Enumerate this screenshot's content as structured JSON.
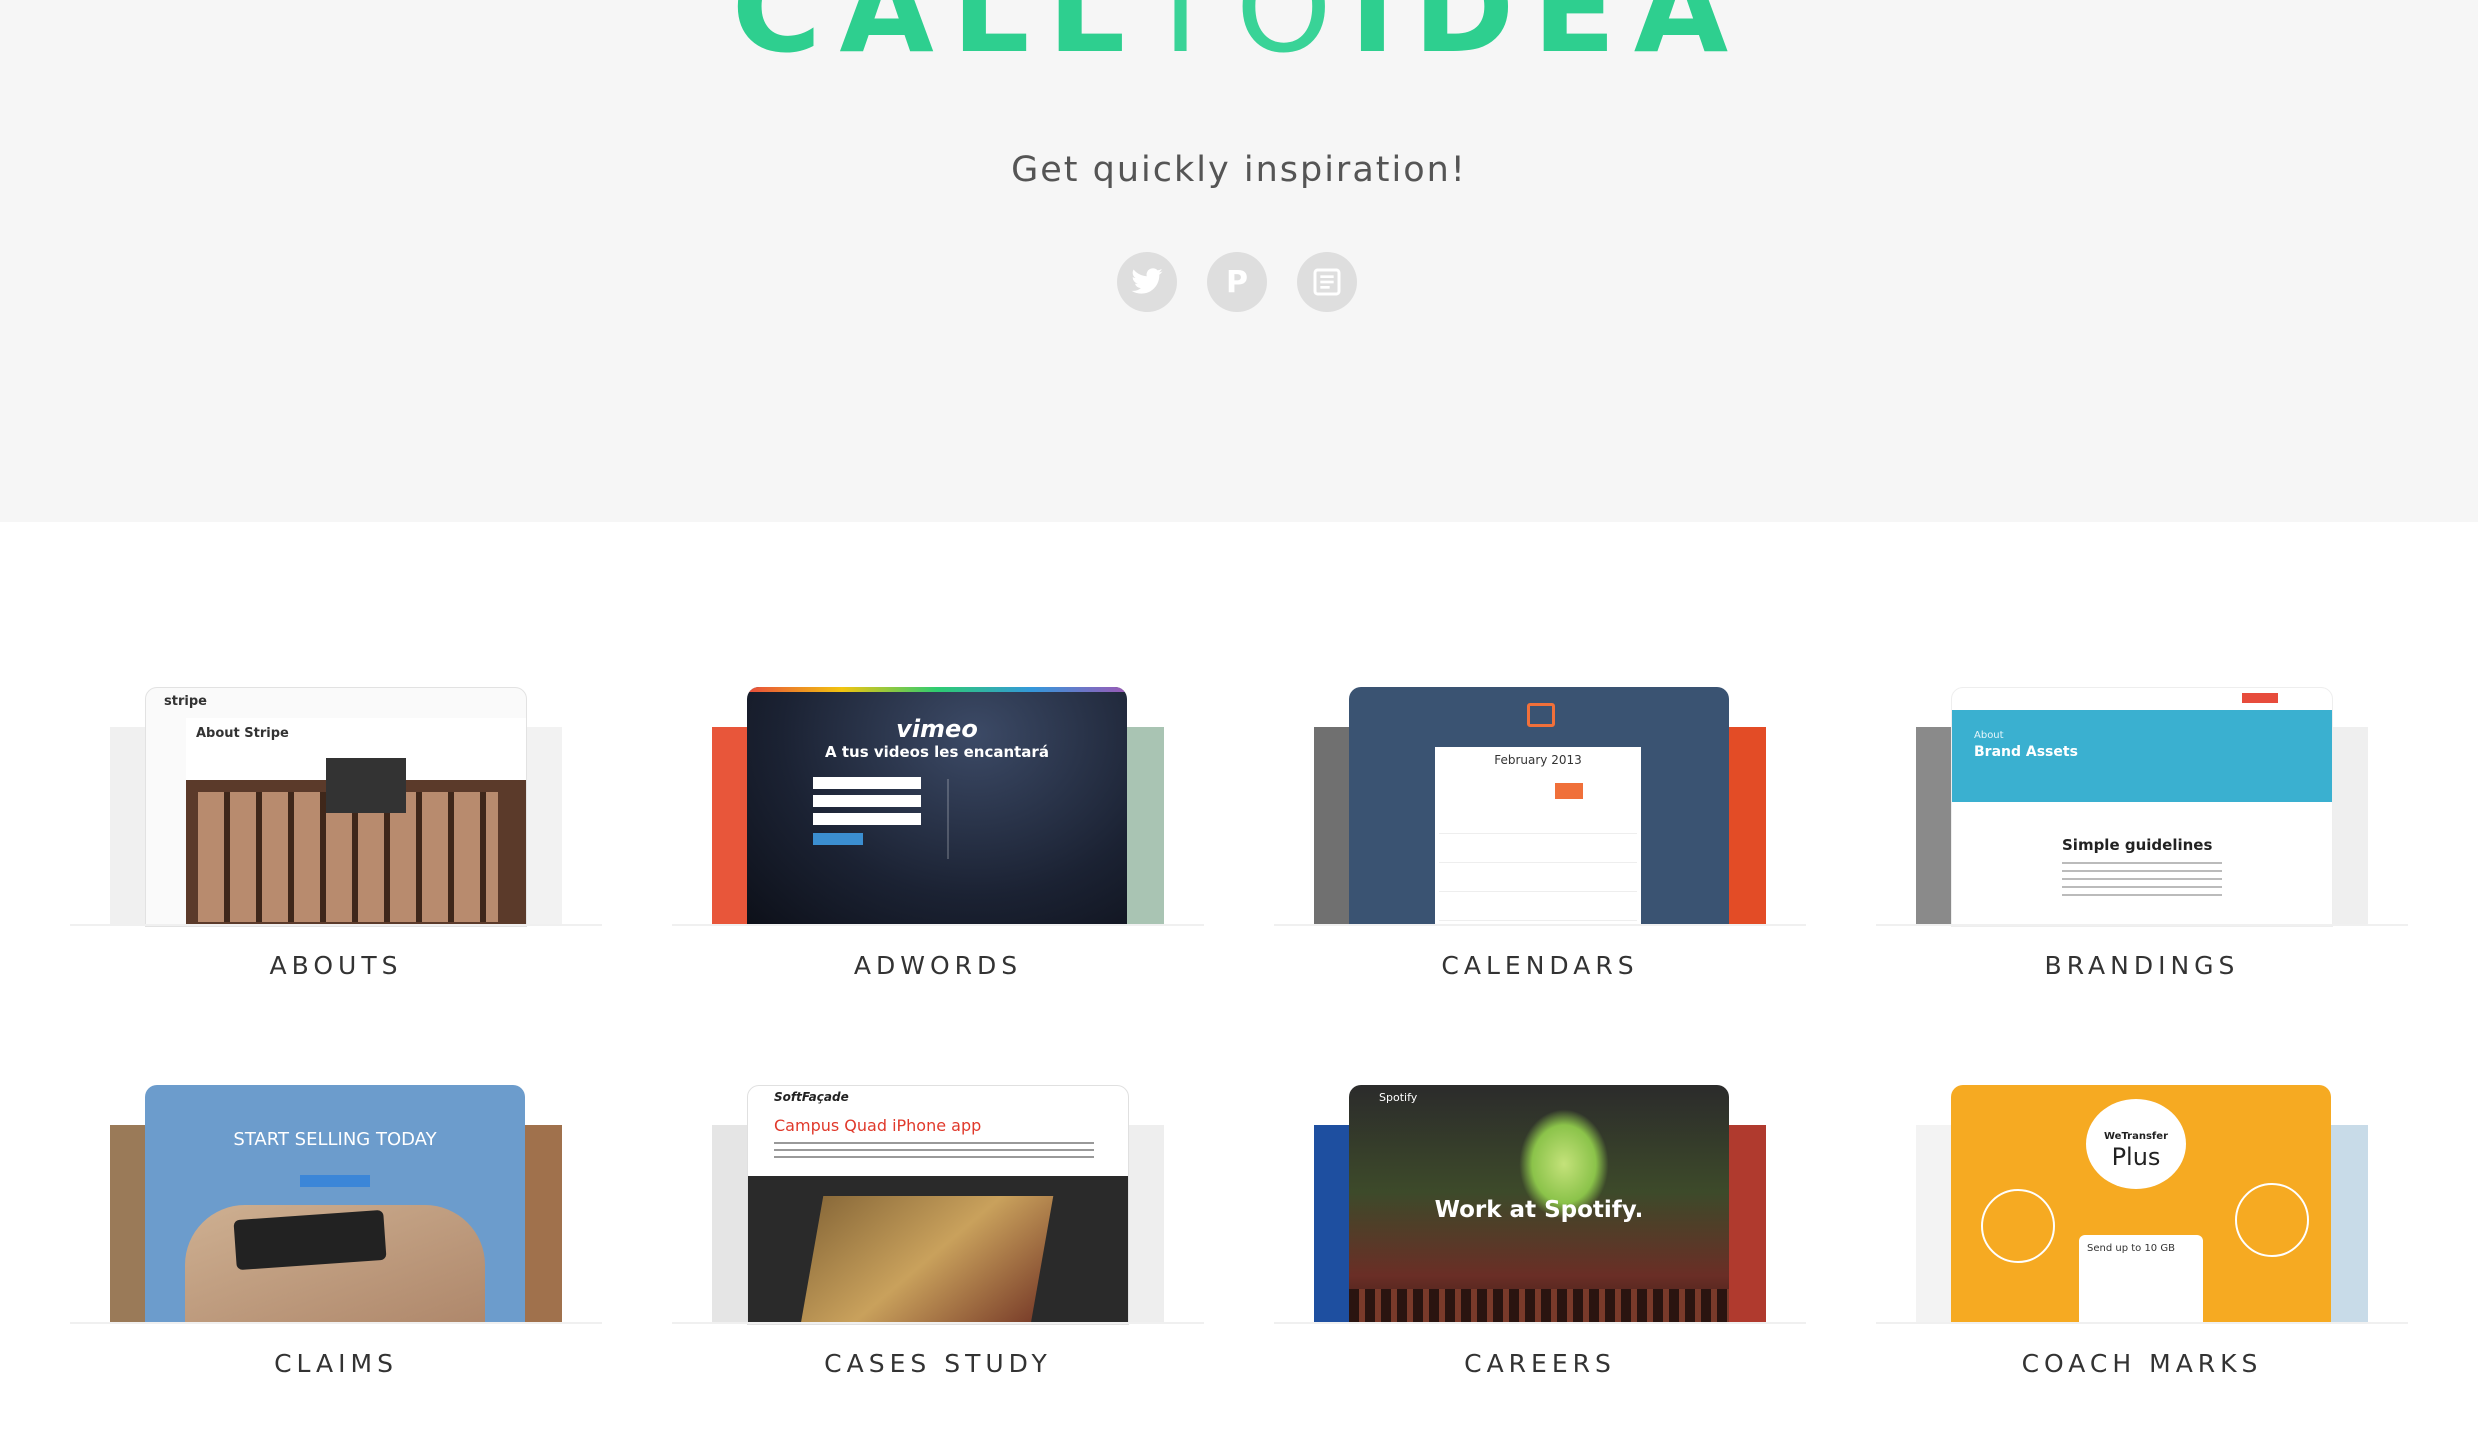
{
  "logo": {
    "part1": "CALL",
    "part2": "TO",
    "part3": "IDEA"
  },
  "tagline": "Get quickly inspiration!",
  "social": [
    {
      "icon": "twitter-icon",
      "glyph": "🐦"
    },
    {
      "icon": "pinterest-icon",
      "glyph": "P"
    },
    {
      "icon": "blog-icon",
      "glyph": "▤"
    }
  ],
  "categories": [
    {
      "title": "ABOUTS"
    },
    {
      "title": "ADWORDS"
    },
    {
      "title": "CALENDARS"
    },
    {
      "title": "BRANDINGS"
    },
    {
      "title": "CLAIMS"
    },
    {
      "title": "CASES STUDY"
    },
    {
      "title": "CAREERS"
    },
    {
      "title": "COACH MARKS"
    }
  ],
  "previews": {
    "abouts": {
      "brand": "stripe",
      "heading": "About Stripe"
    },
    "adwords": {
      "brand": "vimeo",
      "heading": "A tus videos les encantará"
    },
    "calendars": {
      "month": "February 2013"
    },
    "brandings": {
      "label": "About",
      "heading": "Brand Assets",
      "sub": "Simple guidelines"
    },
    "claims": {
      "heading": "START SELLING TODAY"
    },
    "cases": {
      "brand": "SoftFaçade",
      "heading": "Campus Quad iPhone app"
    },
    "careers": {
      "brand": "Spotify",
      "heading": "Work at Spotify."
    },
    "coach": {
      "brand": "WeTransfer",
      "heading": "Plus",
      "sub": "Send up to 10 GB"
    }
  },
  "colors": {
    "accent": "#2ecf8f",
    "hero_bg": "#f6f6f6"
  }
}
